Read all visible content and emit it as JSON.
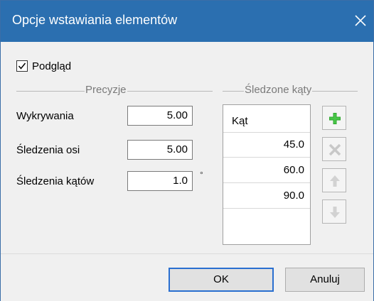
{
  "window": {
    "title": "Opcje wstawiania elementów",
    "close_icon": "close-icon"
  },
  "preview": {
    "label": "Podgląd",
    "checked": true
  },
  "precision": {
    "group_title": "Precyzje",
    "fields": [
      {
        "label": "Wykrywania",
        "value": "5.00"
      },
      {
        "label": "Śledzenia osi",
        "value": "5.00"
      },
      {
        "label": "Śledzenia kątów",
        "value": "1.0",
        "unit": "°"
      }
    ]
  },
  "tracked_angles": {
    "group_title": "Śledzone kąty",
    "column_header": "Kąt",
    "rows": [
      "45.0",
      "60.0",
      "90.0"
    ],
    "buttons": [
      {
        "name": "add",
        "icon": "plus-icon",
        "enabled": true,
        "color": "#2ea82e"
      },
      {
        "name": "delete",
        "icon": "delete-icon",
        "enabled": false
      },
      {
        "name": "move-up",
        "icon": "arrow-up-icon",
        "enabled": false
      },
      {
        "name": "move-down",
        "icon": "arrow-down-icon",
        "enabled": false
      }
    ]
  },
  "footer": {
    "ok_label": "OK",
    "cancel_label": "Anuluj"
  },
  "colors": {
    "titlebar": "#2b6fb0",
    "accent": "#2a6fd0"
  }
}
